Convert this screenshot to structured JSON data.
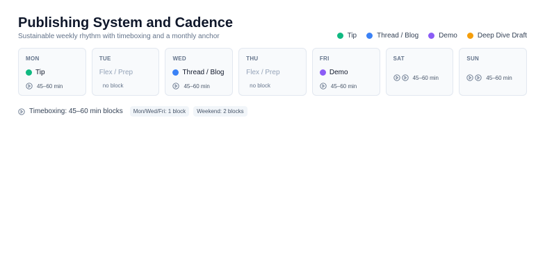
{
  "header": {
    "title": "Publishing System and Cadence",
    "subtitle": "Sustainable weekly rhythm with timeboxing and a monthly anchor"
  },
  "legend": [
    {
      "label": "Tip",
      "color": "#10b981"
    },
    {
      "label": "Thread / Blog",
      "color": "#3b82f6"
    },
    {
      "label": "Demo",
      "color": "#8b5cf6"
    },
    {
      "label": "Deep Dive Draft",
      "color": "#f59e0b"
    }
  ],
  "days": [
    {
      "label": "MON",
      "activity": "Tip",
      "color": "#10b981",
      "duration": "45–60 min"
    },
    {
      "label": "TUE",
      "activity": "Flex / Prep",
      "note": "no block"
    },
    {
      "label": "WED",
      "activity": "Thread / Blog",
      "color": "#3b82f6",
      "duration": "45–60 min"
    },
    {
      "label": "THU",
      "activity": "Flex / Prep",
      "note": "no block"
    },
    {
      "label": "FRI",
      "activity": "Demo",
      "color": "#8b5cf6",
      "duration": "45–60 min"
    },
    {
      "label": "SAT",
      "duration": "45–60 min"
    },
    {
      "label": "SUN",
      "duration": "45–60 min"
    }
  ],
  "footer": {
    "text": "Timeboxing: 45–60 min blocks",
    "chip_weekday": "Mon/Wed/Fri: 1 block",
    "chip_weekend": "Weekend: 2 blocks"
  }
}
